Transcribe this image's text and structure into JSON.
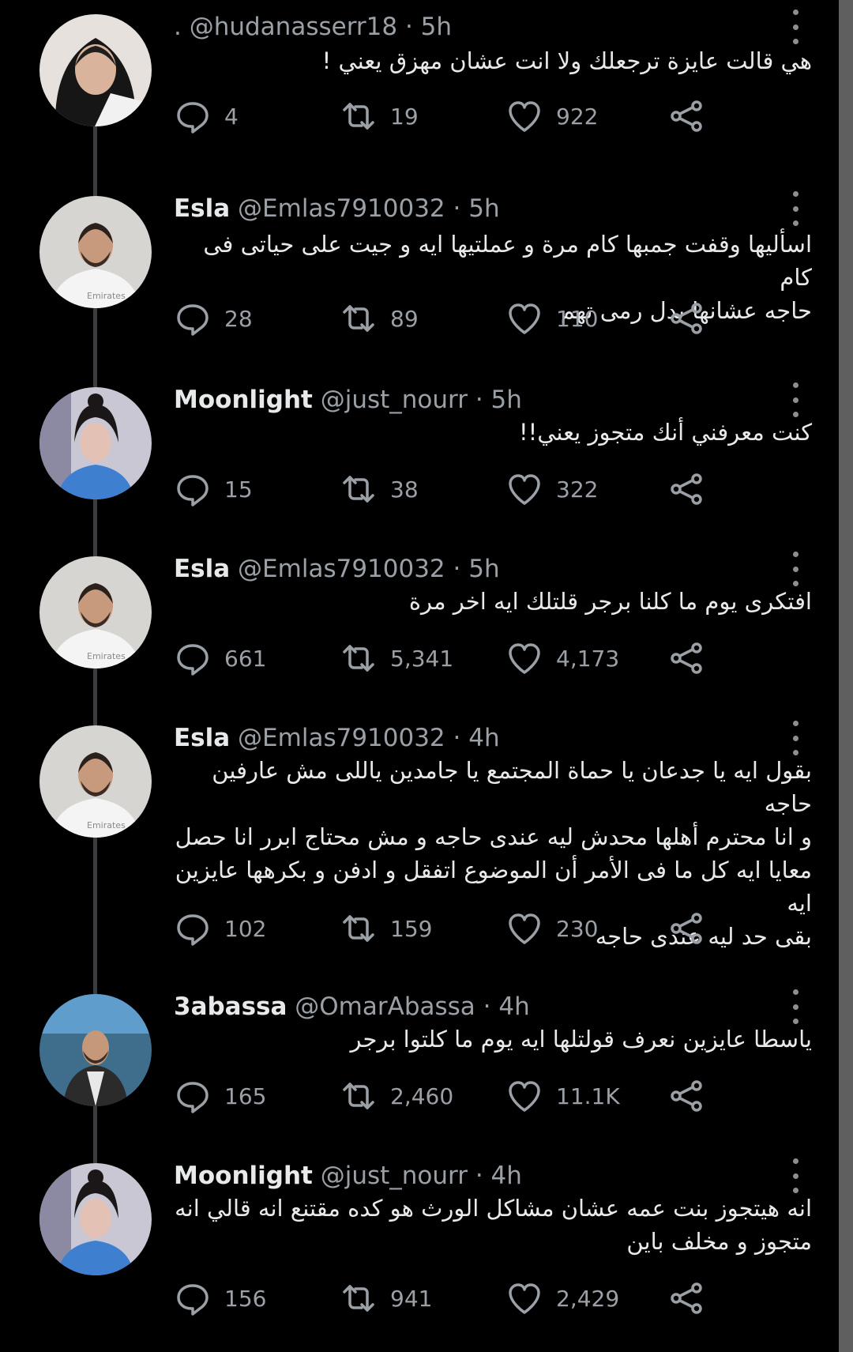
{
  "colors": {
    "background": "#000000",
    "frame": "#5f5f5f",
    "text": "#e7e9ea",
    "muted": "#9aa0a6"
  },
  "tweets": [
    {
      "name": "",
      "handle": ". @hudanasserr18",
      "time": "· 5h",
      "text": "هي قالت عايزة ترجعلك ولا انت عشان مهزق يعني !",
      "replies": "4",
      "retweets": "19",
      "likes": "922"
    },
    {
      "name": "Esla",
      "handle": "@Emlas7910032",
      "time": "· 5h",
      "text": "اسأليها وقفت جمبها كام مرة و عملتيها ايه و جيت على حياتى فى كام\nحاجه عشانها بدل رمى تهم",
      "replies": "28",
      "retweets": "89",
      "likes": "110"
    },
    {
      "name": "Moonlight",
      "handle": "@just_nourr",
      "time": "· 5h",
      "text": "كنت معرفني أنك متجوز يعني!!",
      "replies": "15",
      "retweets": "38",
      "likes": "322"
    },
    {
      "name": "Esla",
      "handle": "@Emlas7910032",
      "time": "· 5h",
      "text": "افتكرى يوم ما كلنا برجر قلتلك ايه اخر مرة",
      "replies": "661",
      "retweets": "5,341",
      "likes": "4,173"
    },
    {
      "name": "Esla",
      "handle": "@Emlas7910032",
      "time": "· 4h",
      "text": "بقول ايه يا جدعان يا حماة المجتمع يا جامدين ياللى مش عارفين حاجه\nو انا محترم أهلها محدش ليه عندى حاجه و مش محتاج ابرر انا حصل\nمعايا ايه كل ما فى الأمر أن الموضوع اتفقل و ادفن و بكرهها عايزين ايه\nبقى حد ليه عندى حاجه",
      "replies": "102",
      "retweets": "159",
      "likes": "230"
    },
    {
      "name": "3abassa",
      "handle": "@OmarAbassa",
      "time": "· 4h",
      "text": "ياسطا عايزين نعرف قولتلها ايه يوم ما كلتوا برجر",
      "replies": "165",
      "retweets": "2,460",
      "likes": "11.1K"
    },
    {
      "name": "Moonlight",
      "handle": "@just_nourr",
      "time": "· 4h",
      "text": "انه هيتجوز بنت عمه عشان مشاكل الورث هو كده مقتنع انه قالي انه\nمتجوز و مخلف باين",
      "replies": "156",
      "retweets": "941",
      "likes": "2,429"
    }
  ]
}
